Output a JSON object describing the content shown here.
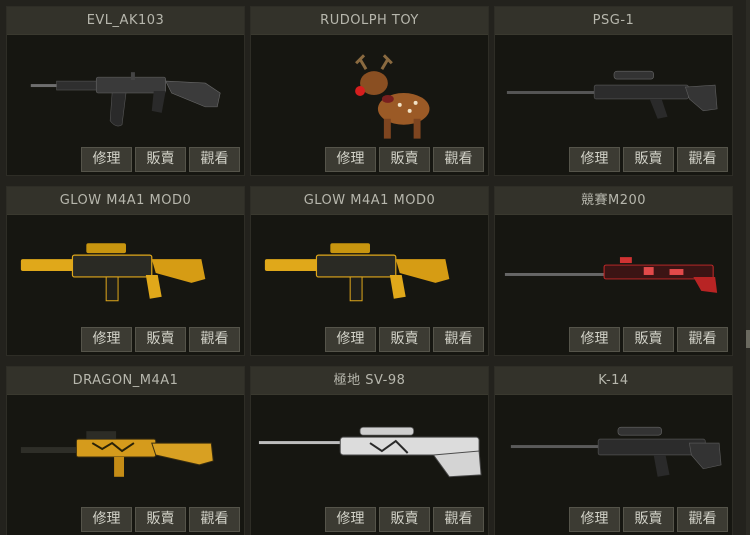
{
  "buttons": {
    "repair": "修理",
    "sell": "販賣",
    "view": "觀看"
  },
  "items": [
    {
      "name": "EVL_AK103",
      "icon": "ak103-rifle-icon"
    },
    {
      "name": "RUDOLPH TOY",
      "icon": "reindeer-toy-icon"
    },
    {
      "name": "PSG-1",
      "icon": "psg1-sniper-icon"
    },
    {
      "name": "GLOW M4A1 MOD0",
      "icon": "gold-m4a1-rifle-icon"
    },
    {
      "name": "GLOW M4A1 MOD0",
      "icon": "gold-m4a1-rifle-icon"
    },
    {
      "name": "競賽M200",
      "icon": "red-m200-sniper-icon"
    },
    {
      "name": "DRAGON_M4A1",
      "icon": "dragon-m4a1-rifle-icon"
    },
    {
      "name": "極地 SV-98",
      "icon": "arctic-sv98-sniper-icon"
    },
    {
      "name": "K-14",
      "icon": "k14-sniper-icon"
    }
  ]
}
